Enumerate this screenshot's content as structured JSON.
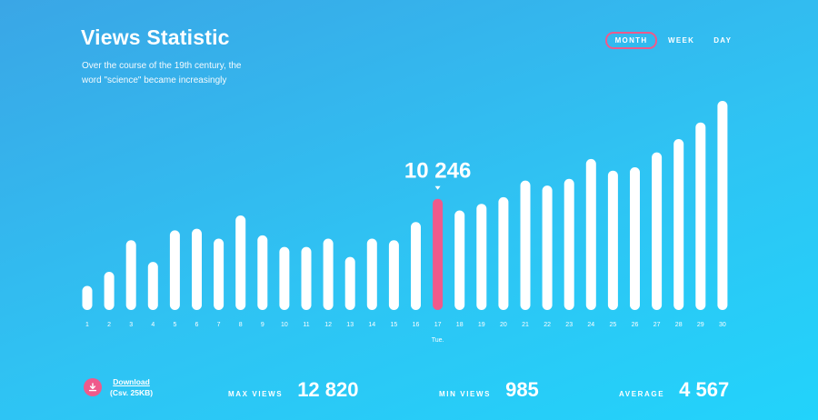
{
  "header": {
    "title": "Views Statistic",
    "subtitle": "Over the course of the 19th century, the word \"science\" became increasingly"
  },
  "period_tabs": [
    {
      "label": "MONTH",
      "active": true
    },
    {
      "label": "WEEK",
      "active": false
    },
    {
      "label": "DAY",
      "active": false
    }
  ],
  "chart_data": {
    "type": "bar",
    "categories": [
      "1",
      "2",
      "3",
      "4",
      "5",
      "6",
      "7",
      "8",
      "9",
      "10",
      "11",
      "12",
      "13",
      "14",
      "15",
      "16",
      "17",
      "18",
      "19",
      "20",
      "21",
      "22",
      "23",
      "24",
      "25",
      "26",
      "27",
      "28",
      "29",
      "30"
    ],
    "values": [
      1450,
      2300,
      4200,
      2900,
      4800,
      4900,
      4300,
      5700,
      4500,
      3800,
      3800,
      4300,
      3200,
      4300,
      4200,
      5300,
      6700,
      6000,
      6400,
      6800,
      7800,
      7500,
      7900,
      9100,
      8400,
      8600,
      9500,
      10300,
      11300,
      12600
    ],
    "highlight": {
      "category": "17",
      "value": "10 246",
      "day_label": "Tue."
    },
    "colors": {
      "bar": "#ffffff",
      "highlight": "#ef5a8b"
    }
  },
  "footer": {
    "download_label": "Download",
    "download_meta": "(Csv. 25KB)",
    "stats": [
      {
        "label": "MAX VIEWS",
        "value": "12 820"
      },
      {
        "label": "MIN VIEWS",
        "value": "985"
      },
      {
        "label": "AVERAGE",
        "value": "4 567"
      }
    ]
  },
  "colors": {
    "accent": "#ef5a8b",
    "background_start": "#3aa6e6",
    "background_end": "#22d3fb"
  }
}
